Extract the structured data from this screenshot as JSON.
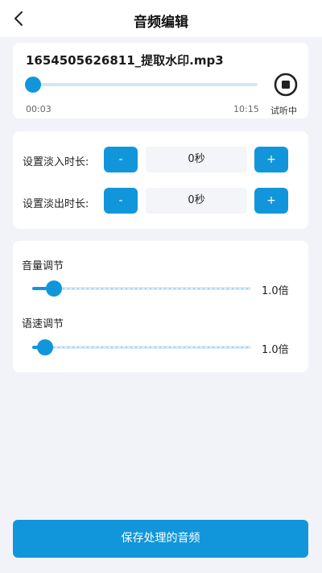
{
  "header": {
    "title": "音频编辑",
    "back_icon": "chevron-left-icon"
  },
  "player": {
    "filename": "1654505626811_提取水印.mp3",
    "current_time": "00:03",
    "total_time": "10:15",
    "progress_fraction": 0.005,
    "status_label": "试听中",
    "stop_icon": "stop-circle-icon"
  },
  "fade": {
    "fade_in": {
      "label": "设置淡入时长:",
      "minus_label": "-",
      "plus_label": "+",
      "value": "0秒"
    },
    "fade_out": {
      "label": "设置淡出时长:",
      "minus_label": "-",
      "plus_label": "+",
      "value": "0秒"
    }
  },
  "adjust": {
    "volume": {
      "label": "音量调节",
      "value_text": "1.0倍",
      "level_fraction": 0.1
    },
    "speed": {
      "label": "语速调节",
      "value_text": "1.0倍",
      "level_fraction": 0.06
    }
  },
  "save_label": "保存处理的音频",
  "colors": {
    "accent": "#1296db",
    "background": "#f2f3f8",
    "card": "#ffffff"
  }
}
